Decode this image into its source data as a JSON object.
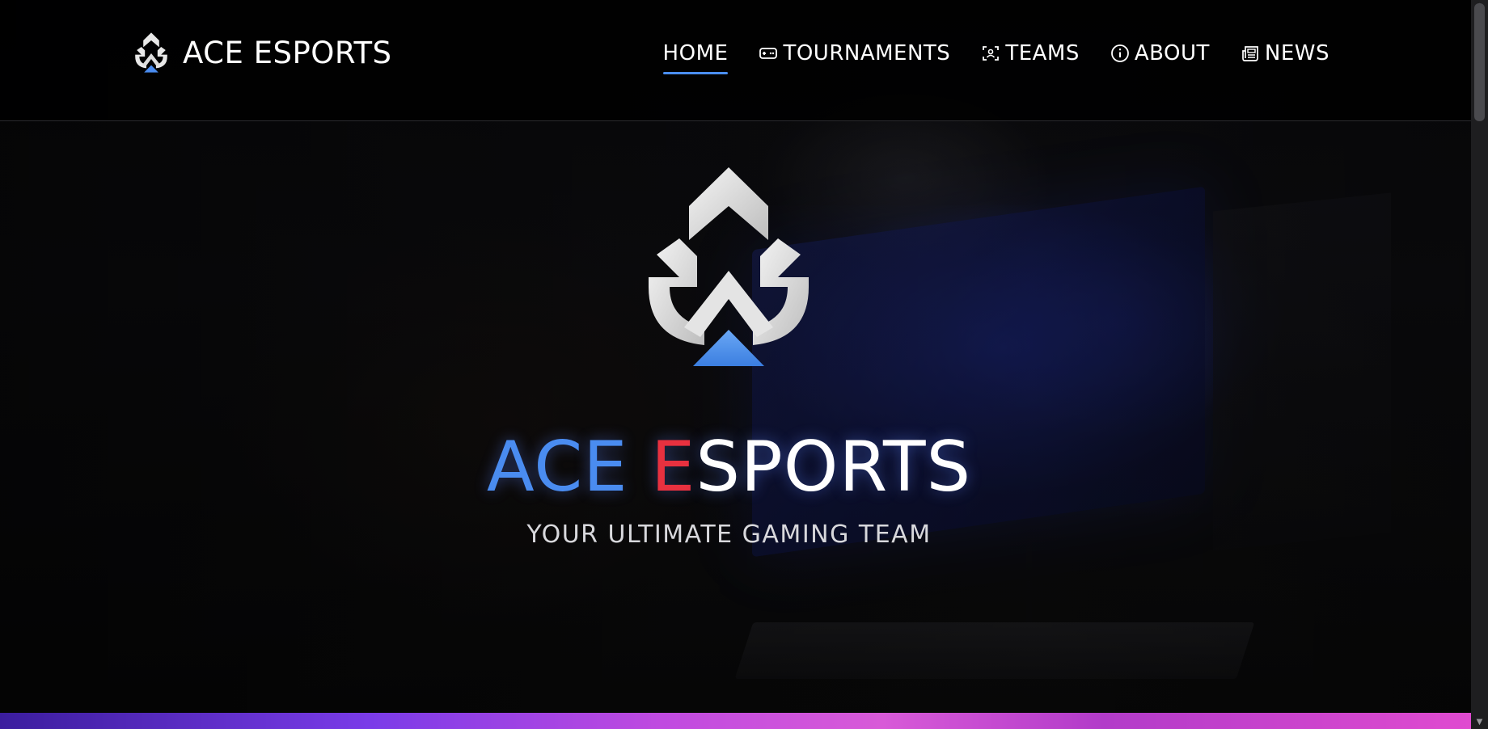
{
  "header": {
    "brand_name": "ACE ESPORTS",
    "nav": [
      {
        "label": "HOME",
        "icon": "none",
        "active": true
      },
      {
        "label": "TOURNAMENTS",
        "icon": "gamepad-icon",
        "active": false
      },
      {
        "label": "TEAMS",
        "icon": "team-scan-icon",
        "active": false
      },
      {
        "label": "ABOUT",
        "icon": "info-icon",
        "active": false
      },
      {
        "label": "NEWS",
        "icon": "newspaper-icon",
        "active": false
      }
    ]
  },
  "hero": {
    "title_part1": "ACE ",
    "title_part2": "E",
    "title_part3": "SPORTS",
    "subtitle": "YOUR ULTIMATE GAMING TEAM"
  },
  "colors": {
    "accent_blue": "#4a8cf0",
    "accent_red": "#e8313f",
    "header_bg": "#000000",
    "nav_underline": "#4a8ef0"
  }
}
